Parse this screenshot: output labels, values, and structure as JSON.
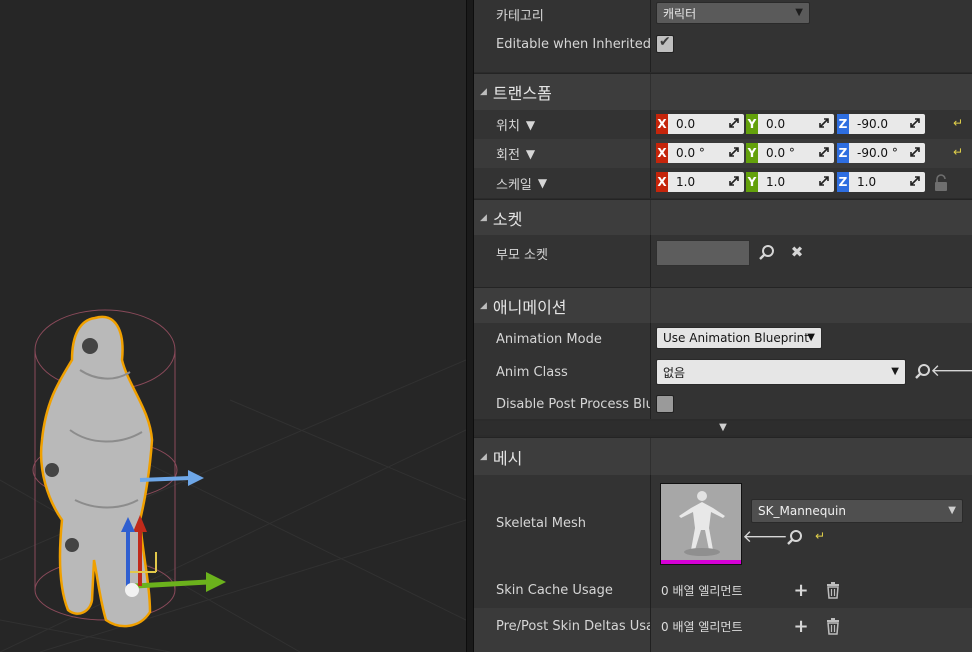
{
  "details": {
    "category_row": {
      "label": "카테고리",
      "value": "캐릭터"
    },
    "editable_row": {
      "label": "Editable when Inherited",
      "checked": true
    },
    "transform": {
      "header": "트랜스폼",
      "location": {
        "label": "위치",
        "x": "0.0",
        "y": "0.0",
        "z": "-90.0"
      },
      "rotation": {
        "label": "회전",
        "x": "0.0 °",
        "y": "0.0 °",
        "z": "-90.0 °"
      },
      "scale": {
        "label": "스케일",
        "x": "1.0",
        "y": "1.0",
        "z": "1.0"
      },
      "axis_labels": {
        "x": "X",
        "y": "Y",
        "z": "Z"
      }
    },
    "socket": {
      "header": "소켓",
      "parent_socket_label": "부모 소켓",
      "parent_socket_value": ""
    },
    "animation": {
      "header": "애니메이션",
      "mode_label": "Animation Mode",
      "mode_value": "Use Animation Blueprint",
      "anim_class_label": "Anim Class",
      "anim_class_value": "없음",
      "disable_pp_label": "Disable Post Process Blueprint",
      "disable_pp_checked": false
    },
    "mesh": {
      "header": "메시",
      "skeletal_mesh_label": "Skeletal Mesh",
      "skeletal_mesh_value": "SK_Mannequin",
      "skin_cache_label": "Skin Cache Usage",
      "skin_cache_value": "0 배열 엘리먼트",
      "skin_deltas_label": "Pre/Post Skin Deltas Usage",
      "skin_deltas_value": "0 배열 엘리먼트"
    }
  },
  "icons": {
    "search": "search-icon",
    "clear": "close-icon",
    "browse": "arrow-left-icon",
    "reset": "reset-to-default-icon",
    "lock": "lock-icon",
    "add": "plus-icon",
    "delete": "trash-icon",
    "expand": "chevron-down-icon"
  },
  "colors": {
    "axis_x": "#c5250b",
    "axis_y": "#63a10b",
    "axis_z": "#2e6ee0",
    "selection_outline": "#f0a000",
    "thumbnail_bar": "#d600d6"
  }
}
